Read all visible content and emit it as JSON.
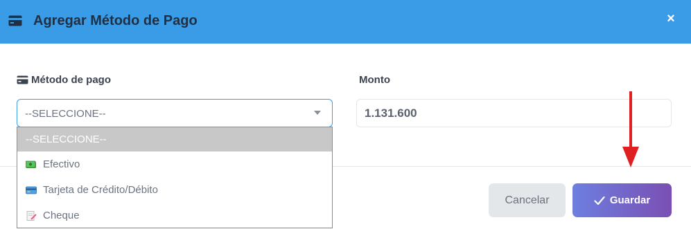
{
  "modal": {
    "title": "Agregar Método de Pago",
    "close_symbol": "×",
    "header_color": "#3a9be6"
  },
  "form": {
    "payment_method_label": "Método de pago",
    "payment_method_value": "--SELECCIONE--",
    "amount_label": "Monto",
    "amount_value": "1.131.600"
  },
  "dropdown": {
    "options": [
      {
        "label": "--SELECCIONE--",
        "icon": "none",
        "selected": true
      },
      {
        "label": "Efectivo",
        "icon": "money-icon",
        "selected": false
      },
      {
        "label": "Tarjeta de Crédito/Débito",
        "icon": "credit-card-icon",
        "selected": false
      },
      {
        "label": "Cheque",
        "icon": "memo-icon",
        "selected": false
      }
    ]
  },
  "footer": {
    "cancel_label": "Cancelar",
    "save_label": "Guardar",
    "save_gradient": [
      "#6d7fe0",
      "#7a4fb3"
    ]
  },
  "annotation": {
    "arrow_color": "#e02020"
  }
}
